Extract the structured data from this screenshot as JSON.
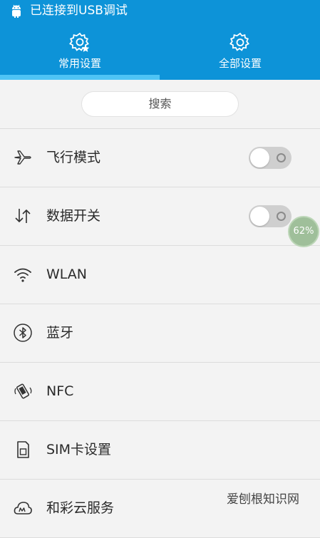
{
  "status_bar": {
    "text": "已连接到USB调试",
    "icon": "android-icon"
  },
  "tabs": [
    {
      "label": "常用设置",
      "icon": "gear-star-icon",
      "active": true
    },
    {
      "label": "全部设置",
      "icon": "gear-icon",
      "active": false
    }
  ],
  "search": {
    "placeholder": "搜索"
  },
  "settings": [
    {
      "label": "飞行模式",
      "icon": "airplane-icon",
      "toggle": "off"
    },
    {
      "label": "数据开关",
      "icon": "data-arrows-icon",
      "toggle": "off"
    },
    {
      "label": "WLAN",
      "icon": "wifi-icon"
    },
    {
      "label": "蓝牙",
      "icon": "bluetooth-icon"
    },
    {
      "label": "NFC",
      "icon": "nfc-phone-icon"
    },
    {
      "label": "SIM卡设置",
      "icon": "sim-card-icon"
    },
    {
      "label": "和彩云服务",
      "icon": "cloud-m-icon"
    }
  ],
  "floating_indicator": {
    "value": "62%"
  },
  "watermark": "爱刨根知识网",
  "colors": {
    "header": "#0d93d8",
    "tab_indicator": "#4ec4f5",
    "background": "#f3f3f3",
    "toggle_off": "#cfcfcf"
  }
}
